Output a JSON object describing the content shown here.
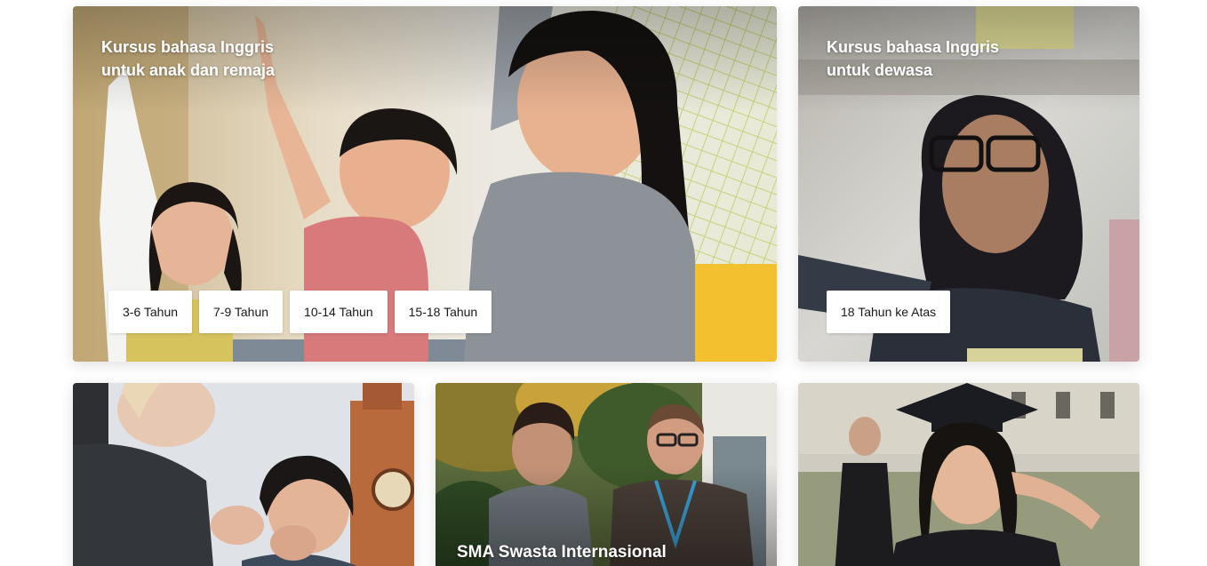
{
  "cards": {
    "kids": {
      "title": "Kursus bahasa Inggris\nuntuk anak dan remaja",
      "age_options": [
        "3-6 Tahun",
        "7-9 Tahun",
        "10-14 Tahun",
        "15-18 Tahun"
      ]
    },
    "adults": {
      "title": "Kursus bahasa Inggris\nuntuk dewasa",
      "age_options": [
        "18 Tahun ke Atas"
      ]
    },
    "high_school": {
      "title": "SMA Swasta Internasional"
    }
  },
  "icons": {
    "kids_photo": "children-raising-hands-photo",
    "adults_photo": "woman-in-hijab-photo",
    "travel_photo": "students-in-london-photo",
    "school_photo": "students-talking-photo",
    "graduate_photo": "graduate-photo"
  },
  "colors": {
    "chip_bg": "#ffffff",
    "title_text": "#ffffff",
    "chip_text": "#191919"
  }
}
